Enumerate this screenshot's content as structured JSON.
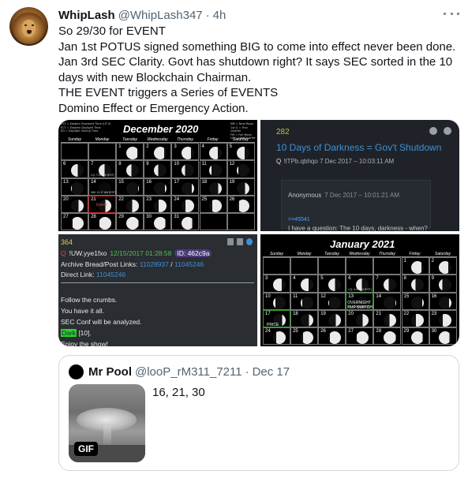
{
  "tweet": {
    "display_name": "WhipLash",
    "handle": "@WhipLash347",
    "separator": "·",
    "time": "4h",
    "more_icon": "more-horizontal-icon",
    "lines": [
      "So 29/30 for EVENT",
      "Jan 1st POTUS signed something BIG to come into effect never been done.",
      "Jan 3rd SEC Clarity. Govt has shutdown right? It says SEC sorted in the 10",
      "days with new Blockchain Chairman.",
      "THE EVENT triggers a Series of EVENTS",
      "Domino Effect or Emergency Action."
    ]
  },
  "media": {
    "cal_dec": {
      "month": "December 2020",
      "legend_left": [
        "EST = Eastern Standard Time (UT-5)",
        "ECT = Eastern Daylight Time",
        "ED = Daylight Saving Time"
      ],
      "legend_right": [
        "NM = New Moon",
        "1st Q = First Quarter",
        "FM = Full Moon",
        "LQ = Last Quarter"
      ],
      "days": [
        "Sunday",
        "Monday",
        "Tuesday",
        "Wednesday",
        "Thursday",
        "Friday",
        "Saturday"
      ],
      "notes": {
        "d7": "LQ: 7:37 PM (EST)",
        "d14": "NM: 11:17 AM (EST)"
      },
      "event_text_21": "Event",
      "event_text_21b": "Lam"
    },
    "qdark": {
      "number": "282",
      "title": "10 Days of Darkness = Gov't Shutdown",
      "meta_q": "Q",
      "meta_trip": "!ITPb.qbhqo",
      "meta_time": "7 Dec 2017 – 10:03:11 AM",
      "anon_name": "Anonymous",
      "anon_time": "7 Dec 2017 – 10:01:21 AM",
      "reply_link": ">>45541",
      "reply_text": "I have a question: The 10 days, darkness - when?",
      "icons": [
        "share-icon",
        "arrow-icon"
      ]
    },
    "qpost": {
      "number": "364",
      "q": "Q",
      "trip": "!UW.yye1fxo",
      "date": "12/15/2017 01:28:58",
      "id": "ID: 462c9a",
      "archive_label": "Archive Bread/Post Links:",
      "archive_link1": "11028937",
      "archive_sep": "/",
      "archive_link2": "11045246",
      "direct_label": "Direct Link:",
      "direct_link": "11045246",
      "body": [
        "Follow the crumbs.",
        "You have it all.",
        "SEC Conf will be analyzed."
      ],
      "dark_word": "Dark",
      "dark_rest": " [10].",
      "last": "Enjoy the show!"
    },
    "cal_jan": {
      "month": "January 2021",
      "days": [
        "Sunday",
        "Monday",
        "Tuesday",
        "Wednesday",
        "Thursday",
        "Friday",
        "Saturday"
      ],
      "notes": {
        "d6": "LQ: 4:37 AM (EST)",
        "d13": "NM: 09:00 AM (EST)"
      },
      "overnight": [
        "OVERNIGHT",
        "FLIP SWITCH"
      ],
      "price": "PRICE"
    }
  },
  "quote": {
    "display_name": "Mr Pool",
    "handle": "@looP_rM311_7211",
    "separator": "·",
    "time": "Dec 17",
    "text": "16, 21, 30",
    "gif_label": "GIF"
  }
}
